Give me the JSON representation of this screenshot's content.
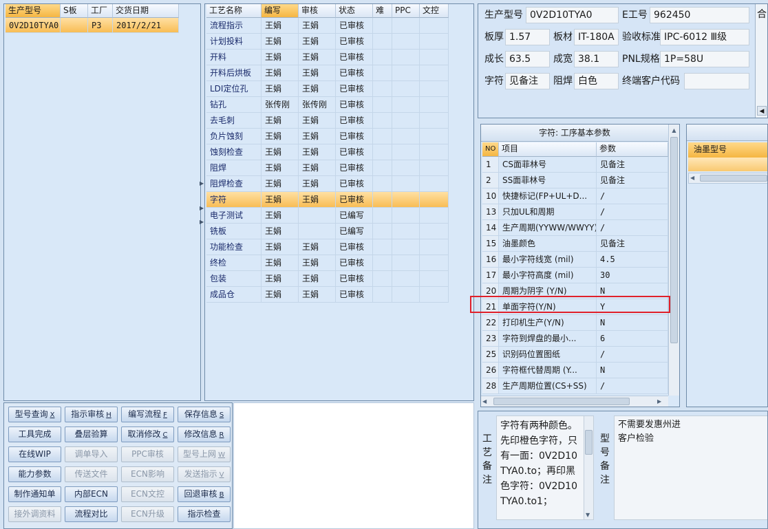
{
  "models_grid": {
    "headers": [
      "生产型号",
      "S板",
      "工厂",
      "交货日期"
    ],
    "rows": [
      [
        "0V2D10TYA0",
        "",
        "P3",
        "2017/2/21"
      ]
    ]
  },
  "process_grid": {
    "headers": [
      "工艺名称",
      "编写",
      "审核",
      "状态",
      "难",
      "PPC",
      "文控"
    ],
    "selected_index": 11,
    "rows": [
      [
        "流程指示",
        "王娟",
        "王娟",
        "已审核"
      ],
      [
        "计划投料",
        "王娟",
        "王娟",
        "已审核"
      ],
      [
        "开料",
        "王娟",
        "王娟",
        "已审核"
      ],
      [
        "开料后烘板",
        "王娟",
        "王娟",
        "已审核"
      ],
      [
        "LDI定位孔",
        "王娟",
        "王娟",
        "已审核"
      ],
      [
        "钻孔",
        "张传刚",
        "张传刚",
        "已审核"
      ],
      [
        "去毛刺",
        "王娟",
        "王娟",
        "已审核"
      ],
      [
        "负片蚀刻",
        "王娟",
        "王娟",
        "已审核"
      ],
      [
        "蚀刻检查",
        "王娟",
        "王娟",
        "已审核"
      ],
      [
        "阻焊",
        "王娟",
        "王娟",
        "已审核"
      ],
      [
        "阻焊检查",
        "王娟",
        "王娟",
        "已审核"
      ],
      [
        "字符",
        "王娟",
        "王娟",
        "已审核"
      ],
      [
        "电子测试",
        "王娟",
        "",
        "已编写"
      ],
      [
        "铣板",
        "王娟",
        "",
        "已编写"
      ],
      [
        "功能检查",
        "王娟",
        "王娟",
        "已审核"
      ],
      [
        "终检",
        "王娟",
        "王娟",
        "已审核"
      ],
      [
        "包装",
        "王娟",
        "王娟",
        "已审核"
      ],
      [
        "成品仓",
        "王娟",
        "王娟",
        "已审核"
      ]
    ]
  },
  "product_info": {
    "model_label": "生产型号",
    "model_value": "0V2D10TYA0",
    "e_no_label": "E工号",
    "e_no_value": "962450",
    "thickness_label": "板厚",
    "thickness_value": "1.57",
    "material_label": "板材",
    "material_value": "IT-180A",
    "standard_label": "验收标准",
    "standard_value": "IPC-6012 Ⅲ级",
    "length_label": "成长",
    "length_value": "63.5",
    "width_label": "成宽",
    "width_value": "38.1",
    "pnl_label": "PNL规格",
    "pnl_value": "1P=58U",
    "char_label": "字符",
    "char_value": "见备注",
    "mask_label": "阻焊",
    "mask_value": "白色",
    "customer_label": "终端客户代码",
    "customer_value": "",
    "cut_right": "合"
  },
  "params_grid": {
    "title": "字符: 工序基本参数",
    "headers": [
      "NO",
      "项目",
      "参数"
    ],
    "highlighted_no": "21",
    "rows": [
      [
        "1",
        "CS面菲林号",
        "见备注"
      ],
      [
        "2",
        "SS面菲林号",
        "见备注"
      ],
      [
        "10",
        "快捷标记(FP+UL+D...",
        "/"
      ],
      [
        "13",
        "只加UL和周期",
        "/"
      ],
      [
        "14",
        "生产周期(YYWW/WWYY)",
        "/"
      ],
      [
        "15",
        "油墨颜色",
        "见备注"
      ],
      [
        "16",
        "最小字符线宽 (mil)",
        "4.5"
      ],
      [
        "17",
        "最小字符高度 (mil)",
        "30"
      ],
      [
        "20",
        "周期为阴字 (Y/N)",
        "N"
      ],
      [
        "21",
        "单面字符(Y/N)",
        "Y"
      ],
      [
        "22",
        "打印机生产(Y/N)",
        "N"
      ],
      [
        "23",
        "字符到焊盘的最小...",
        "6"
      ],
      [
        "25",
        "识别码位置图纸",
        "/"
      ],
      [
        "26",
        "字符框代替周期 (Y...",
        "N"
      ],
      [
        "28",
        "生产周期位置(CS+SS)",
        "/"
      ]
    ]
  },
  "ink_grid": {
    "header": "油墨型号"
  },
  "remarks": {
    "process_label": "工艺备注",
    "process_text": "字符有两种颜色。先印橙色字符，只有一面：0V2D10TYA0.to；再印黑色字符：0V2D10TYA0.to1；",
    "model_label": "型号备注",
    "model_text": "不需要发惠州进客户检验"
  },
  "buttons": [
    {
      "label": "型号查询",
      "key": "X",
      "enabled": true
    },
    {
      "label": "指示审核",
      "key": "H",
      "enabled": true
    },
    {
      "label": "编写流程",
      "key": "F",
      "enabled": true
    },
    {
      "label": "保存信息",
      "key": "S",
      "enabled": true
    },
    {
      "label": "工具完成",
      "key": "",
      "enabled": true
    },
    {
      "label": "叠层验算",
      "key": "",
      "enabled": true
    },
    {
      "label": "取消修改",
      "key": "C",
      "enabled": true
    },
    {
      "label": "修改信息",
      "key": "R",
      "enabled": true
    },
    {
      "label": "在线WIP",
      "key": "",
      "enabled": true
    },
    {
      "label": "调单导入",
      "key": "",
      "enabled": false
    },
    {
      "label": "PPC审核",
      "key": "",
      "enabled": false
    },
    {
      "label": "型号上网",
      "key": "W",
      "enabled": false
    },
    {
      "label": "能力参数",
      "key": "",
      "enabled": true
    },
    {
      "label": "传送文件",
      "key": "",
      "enabled": false
    },
    {
      "label": "ECN影响",
      "key": "",
      "enabled": false
    },
    {
      "label": "发送指示",
      "key": "V",
      "enabled": false
    },
    {
      "label": "制作通知单",
      "key": "",
      "enabled": true
    },
    {
      "label": "内部ECN",
      "key": "",
      "enabled": true
    },
    {
      "label": "ECN文控",
      "key": "",
      "enabled": false
    },
    {
      "label": "回退审核",
      "key": "B",
      "enabled": true
    },
    {
      "label": "接外调资料",
      "key": "",
      "enabled": false
    },
    {
      "label": "流程对比",
      "key": "",
      "enabled": true
    },
    {
      "label": "ECN升级",
      "key": "",
      "enabled": false
    },
    {
      "label": "指示检查",
      "key": "",
      "enabled": true
    }
  ],
  "colors": {
    "accent": "#f5b642",
    "highlight_box": "#e0202a",
    "panel": "#d9e8f8"
  }
}
